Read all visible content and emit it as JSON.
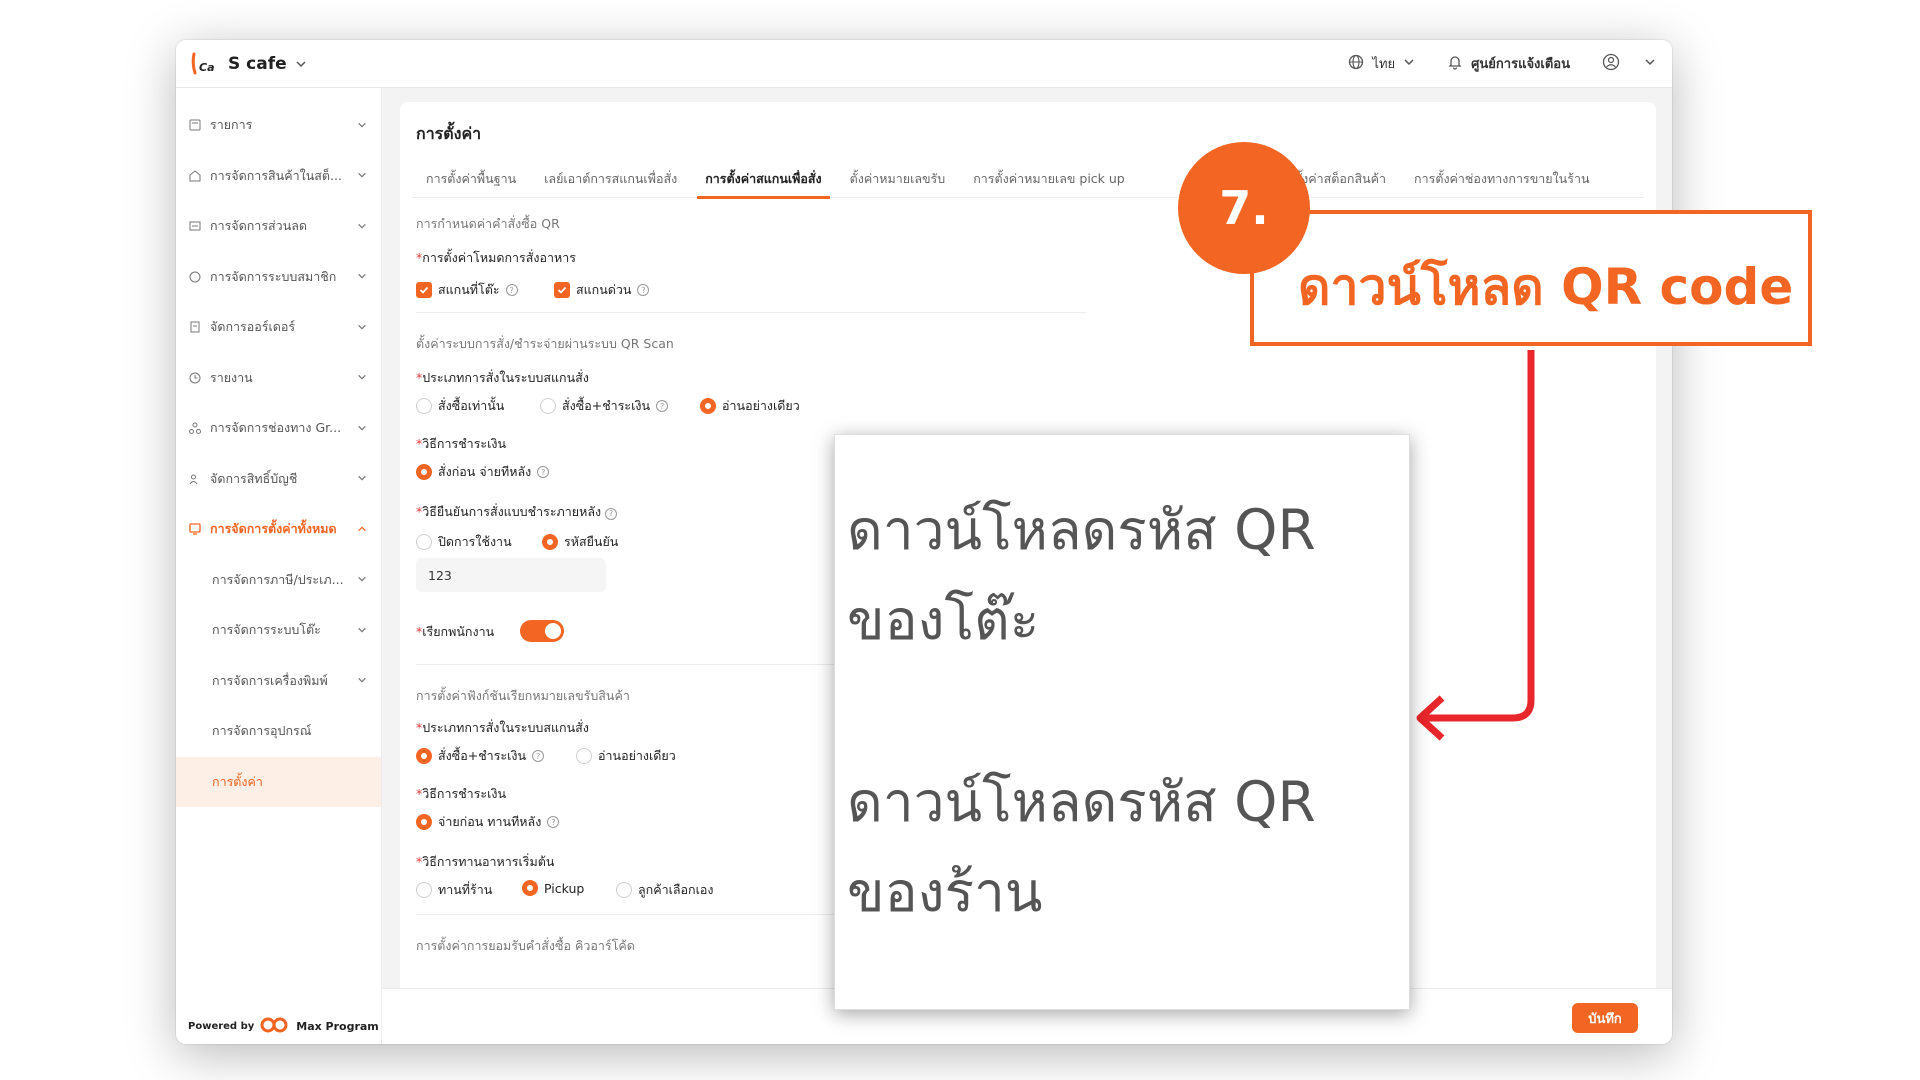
{
  "app": {
    "store_name": "S cafe",
    "language": "ไทย",
    "notification_center": "ศูนย์การแจ้งเตือน"
  },
  "sidebar": {
    "items": [
      {
        "label": "รายการ"
      },
      {
        "label": "การจัดการสินค้าในสต็..."
      },
      {
        "label": "การจัดการส่วนลด"
      },
      {
        "label": "การจัดการระบบสมาชิก"
      },
      {
        "label": "จัดการออร์เดอร์"
      },
      {
        "label": "รายงาน"
      },
      {
        "label": "การจัดการช่องทาง Gr..."
      },
      {
        "label": "จัดการสิทธิ์บัญชี"
      },
      {
        "label": "การจัดการตั้งค่าทั้งหมด"
      },
      {
        "label": "การจัดการภาษี/ประเภ..."
      },
      {
        "label": "การจัดการระบบโต๊ะ"
      },
      {
        "label": "การจัดการเครื่องพิมพ์"
      },
      {
        "label": "การจัดการอุปกรณ์"
      },
      {
        "label": "การตั้งค่า"
      }
    ],
    "powered_by": "Powered by",
    "brand": "Max Program"
  },
  "page": {
    "title": "การตั้งค่า",
    "tabs": [
      "การตั้งค่าพื้นฐาน",
      "เลย์เอาต์การสแกนเพื่อสั่ง",
      "การตั้งค่าสแกนเพื่อสั่ง",
      "ตั้งค่าหมายเลขรับ",
      "การตั้งค่าหมายเลข pick up",
      "การตั้งค่าสต็อกสินค้า",
      "การตั้งค่าช่องทางการขายในร้าน"
    ]
  },
  "form": {
    "sec1": "การกำหนดค่าคำสั่งซื้อ QR",
    "food_mode_label": "การตั้งค่าโหมดการสั่งอาหาร",
    "scan_table": "สแกนที่โต๊ะ",
    "scan_express": "สแกนด่วน",
    "sec2": "ตั้งค่าระบบการสั่ง/ชำระจ่ายผ่านระบบ QR Scan",
    "order_type_label": "ประเภทการสั่งในระบบสแกนสั่ง",
    "order_only": "สั่งซื้อเท่านั้น",
    "order_pay": "สั่งซื้อ+ชำระเงิน",
    "read_only": "อ่านอย่างเดียว",
    "payment_label": "วิธีการชำระเงิน",
    "pay_later": "สั่งก่อน จ่ายทีหลัง",
    "confirm_label": "วิธียืนยันการสั่งแบบชำระภายหลัง",
    "disabled": "ปิดการใช้งาน",
    "passcode": "รหัสยืนยัน",
    "passcode_value": "123",
    "call_staff": "เรียกพนักงาน",
    "sec3": "การตั้งค่าฟังก์ชันเรียกหมายเลขรับสินค้า",
    "order_type_label2": "ประเภทการสั่งในระบบสแกนสั่ง",
    "order_pay2": "สั่งซื้อ+ชำระเงิน",
    "read_only2": "อ่านอย่างเดียว",
    "payment_label2": "วิธีการชำระเงิน",
    "pay_first": "จ่ายก่อน ทานทีหลัง",
    "dining_label": "วิธีการทานอาหารเริ่มต้น",
    "dine_in": "ทานที่ร้าน",
    "pickup": "Pickup",
    "customer_choice": "ลูกค้าเลือกเอง",
    "sec4": "การตั้งค่าการยอมรับคำสั่งซื้อ คิวอาร์โค้ด"
  },
  "save_label": "บันทึก",
  "overlay": {
    "step": "7.",
    "callout": "ดาวน์โหลด QR code",
    "zoom_line1": "ดาวน์โหลดรหัส QR",
    "zoom_line2": "ของโต๊ะ",
    "zoom_line3": "ดาวน์โหลดรหัส QR",
    "zoom_line4": "ของร้าน"
  },
  "colors": {
    "accent": "#f26522",
    "arrow": "#e8262b"
  }
}
